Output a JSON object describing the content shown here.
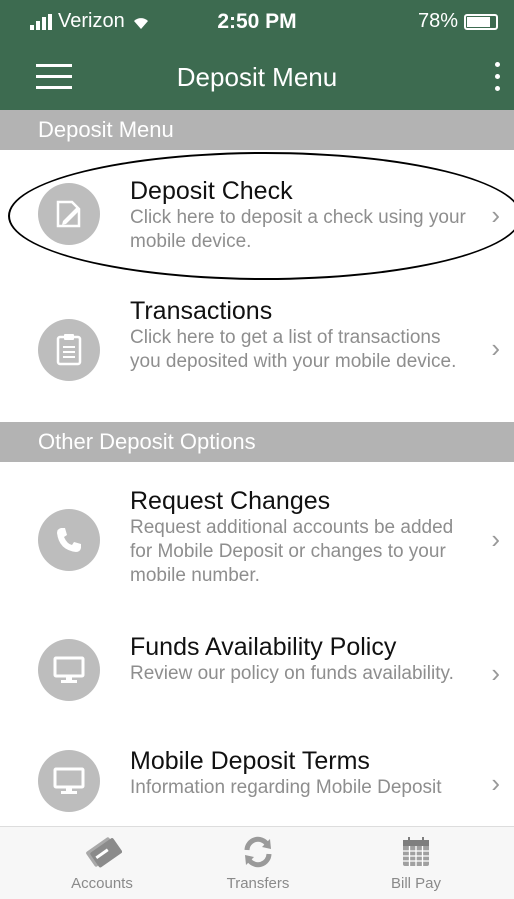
{
  "status": {
    "carrier": "Verizon",
    "time": "2:50 PM",
    "battery": "78%",
    "battery_level": 0.78
  },
  "header": {
    "title": "Deposit Menu"
  },
  "sections": [
    {
      "label": "Deposit Menu"
    },
    {
      "label": "Other Deposit Options"
    }
  ],
  "items": [
    {
      "title": "Deposit Check",
      "desc": "Click here to deposit a check using your mobile device.",
      "icon": "edit-document-icon"
    },
    {
      "title": "Transactions",
      "desc": "Click here to get a list of transactions you deposited with your mobile device.",
      "icon": "clipboard-icon"
    },
    {
      "title": "Request Changes",
      "desc": "Request additional accounts be added for Mobile Deposit or changes to your mobile number.",
      "icon": "phone-icon"
    },
    {
      "title": "Funds Availability Policy",
      "desc": "Review our policy on funds availability.",
      "icon": "monitor-icon"
    },
    {
      "title": "Mobile Deposit Terms",
      "desc": "Information regarding Mobile Deposit",
      "icon": "monitor-icon"
    }
  ],
  "tabs": [
    {
      "label": "Accounts",
      "icon": "cards-icon"
    },
    {
      "label": "Transfers",
      "icon": "refresh-icon"
    },
    {
      "label": "Bill Pay",
      "icon": "calendar-icon"
    }
  ]
}
